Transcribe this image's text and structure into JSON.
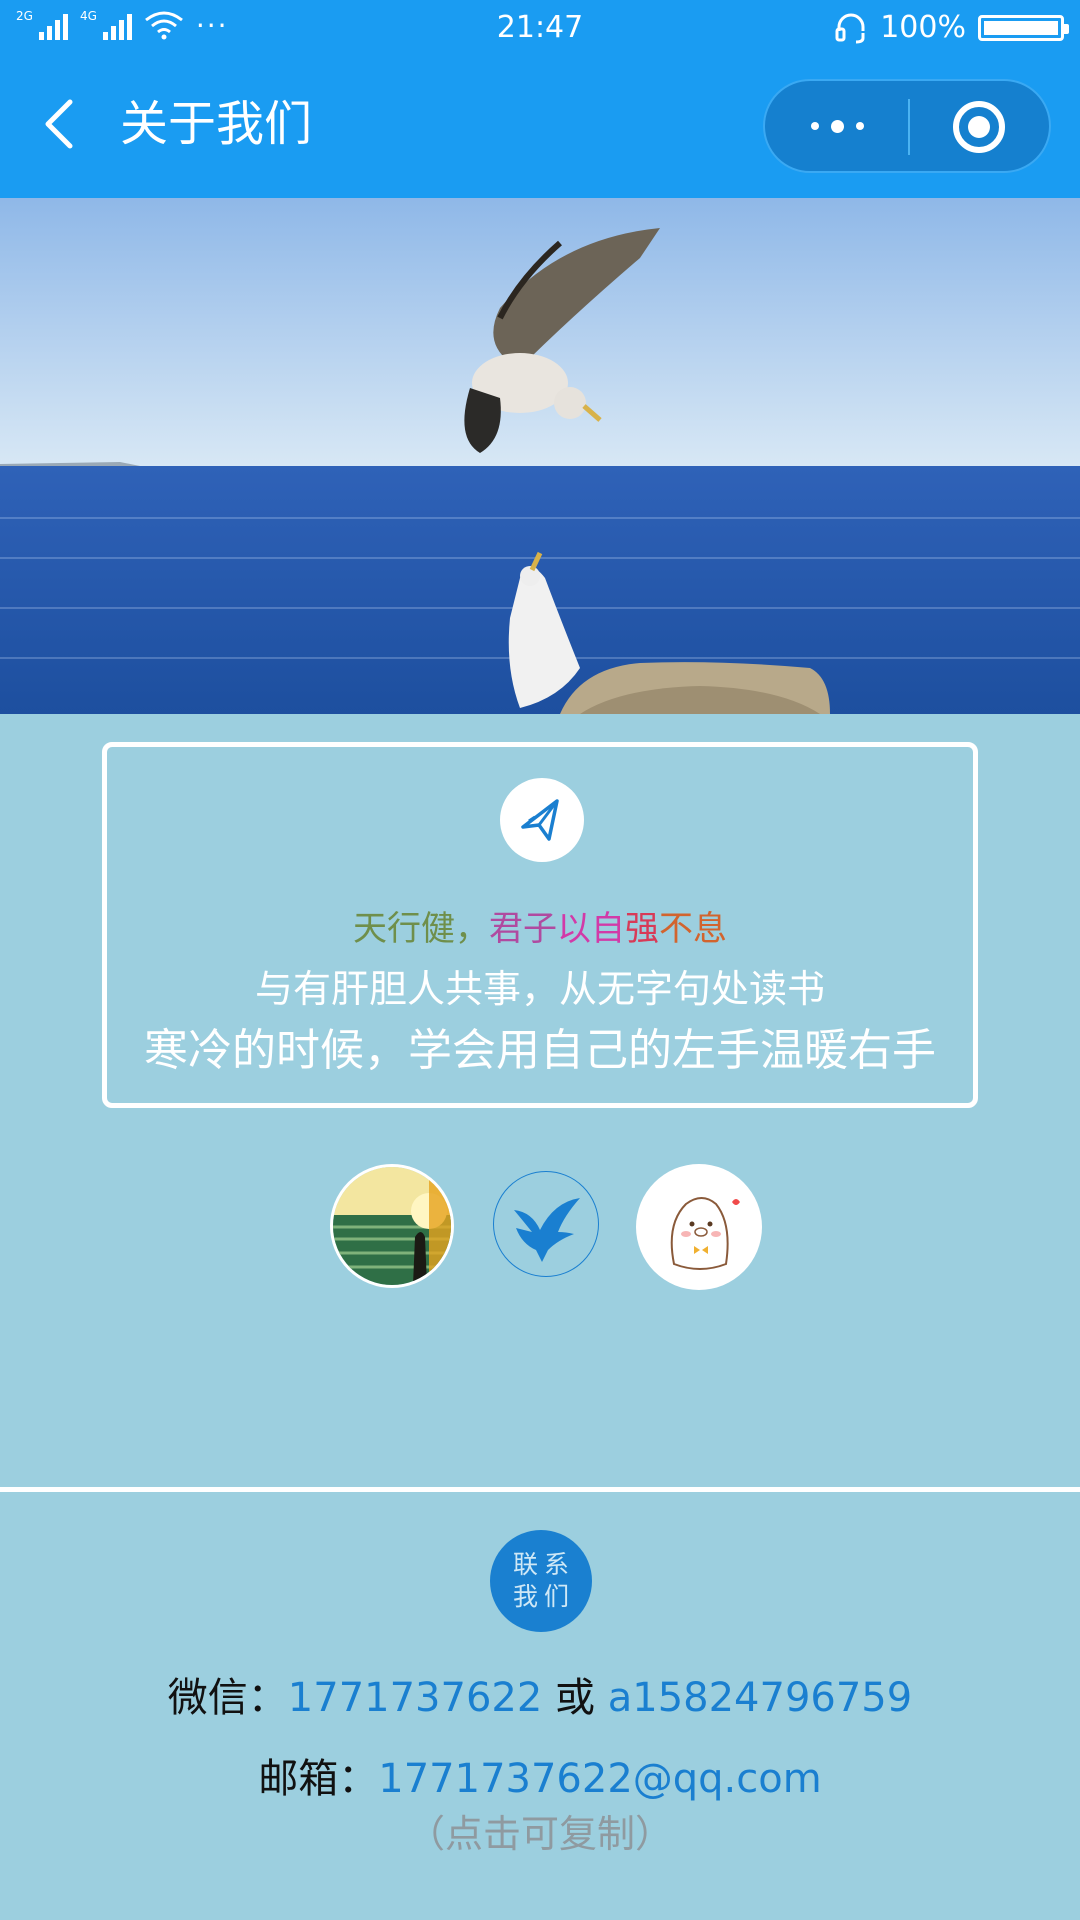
{
  "status": {
    "network1": "2G",
    "network2": "4G",
    "more": "···",
    "time": "21:47",
    "battery": "100%"
  },
  "nav": {
    "title": "关于我们"
  },
  "quote": {
    "line1_parts": [
      {
        "text": "天行健，",
        "color": "#6f8f4b"
      },
      {
        "text": "君子",
        "color": "#b04aa0"
      },
      {
        "text": "以自",
        "color": "#d23aa8"
      },
      {
        "text": "强",
        "color": "#d83a57"
      },
      {
        "text": "不息",
        "color": "#d2642e"
      }
    ],
    "line2": "与有肝胆人共事，从无字句处读书",
    "line3": "寒冷的时候，学会用自己的左手温暖右手"
  },
  "avatars": [
    "sunset-avatar",
    "dove-avatar",
    "seal-avatar"
  ],
  "contact": {
    "badge_line1": "联系",
    "badge_line2": "我们",
    "wechat_label": "微信：",
    "wechat_id1": "1771737622",
    "wechat_or": " 或 ",
    "wechat_id2": "a15824796759",
    "email_label": "邮箱：",
    "email": "1771737622@qq.com",
    "copy_hint": "（点击可复制）"
  },
  "colors": {
    "nav_bg": "#1a9cf2",
    "page_bg": "#9ccfdf",
    "link": "#1a7fd0"
  }
}
